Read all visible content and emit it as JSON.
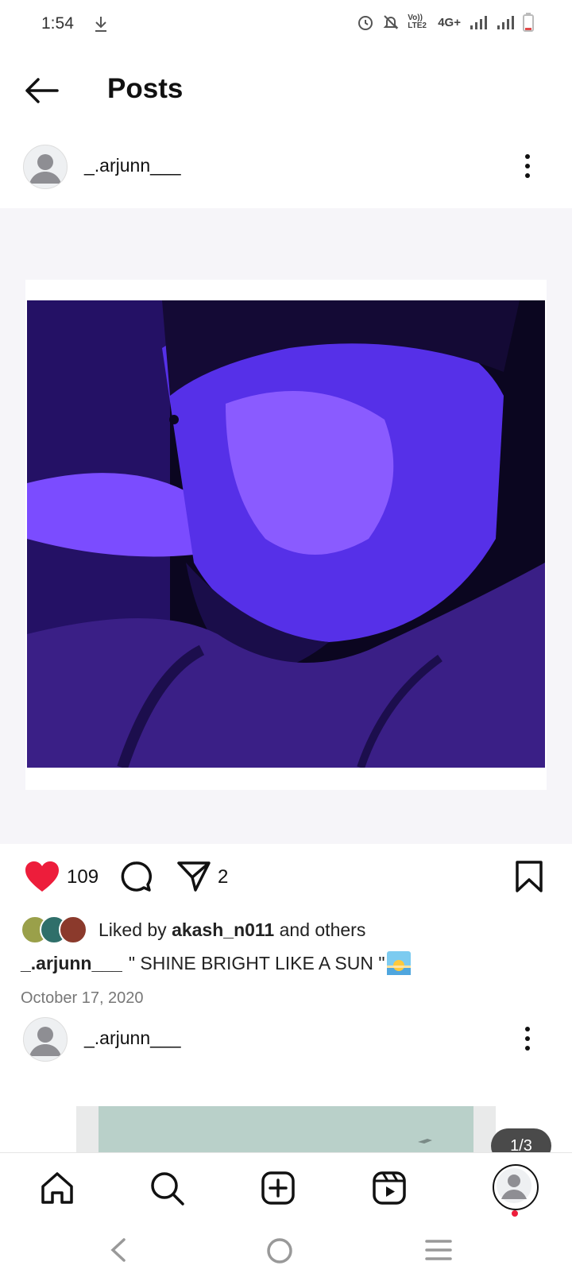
{
  "status_bar": {
    "time": "1:54",
    "network": "4G+",
    "volte": "Vo)) LTE2",
    "icons": [
      "download-icon",
      "alarm-icon",
      "mute-icon",
      "volte-icon",
      "signal-icon",
      "signal-icon",
      "battery-icon"
    ]
  },
  "header": {
    "title": "Posts",
    "back_icon": "arrow-left-icon"
  },
  "post": {
    "username": "_.arjunn___",
    "likes": "109",
    "shares": "2",
    "liked_by_prefix": "Liked by ",
    "liked_by_user": "akash_n011",
    "liked_by_suffix": " and others",
    "caption_user": "_.arjunn___",
    "caption_text": "\" SHINE  BRIGHT LIKE A SUN \"",
    "date": "October 17, 2020"
  },
  "next_post": {
    "username": "_.arjunn___",
    "pager": "1/3"
  },
  "bottom_nav": {
    "items": [
      "home-icon",
      "search-icon",
      "create-icon",
      "reels-icon",
      "profile-icon"
    ]
  },
  "system_nav": {
    "items": [
      "back-icon",
      "home-circle-icon",
      "recents-icon"
    ]
  },
  "colors": {
    "like": "#ed1d3b",
    "photo_tint": "#5b2bd8",
    "text": "#111111",
    "muted": "#777777"
  }
}
